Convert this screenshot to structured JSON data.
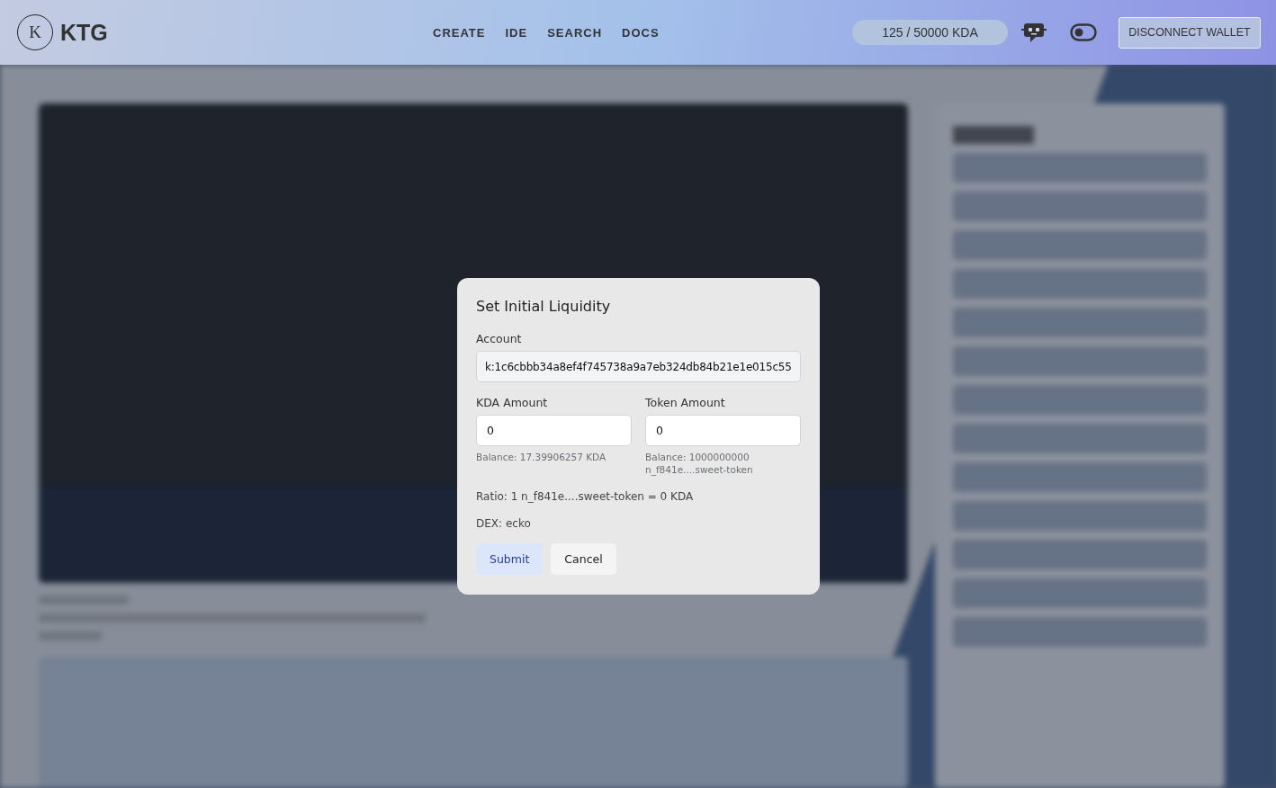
{
  "header": {
    "logo_letter": "K",
    "brand": "KTG",
    "nav": [
      {
        "label": "CREATE"
      },
      {
        "label": "IDE"
      },
      {
        "label": "SEARCH"
      },
      {
        "label": "DOCS"
      }
    ],
    "balance": "125 / 50000 KDA",
    "theme_toggle": {
      "on": false
    },
    "wallet_button": "DISCONNECT WALLET"
  },
  "dialog": {
    "title": "Set Initial Liquidity",
    "account": {
      "label": "Account",
      "value": "k:1c6cbbb34a8ef4f745738a9a7eb324db84b21e1e015c55"
    },
    "amounts": [
      {
        "label": "KDA Amount",
        "value": "0",
        "hint": [
          "Balance: 17.39906257 KDA"
        ]
      },
      {
        "label": "Token Amount",
        "value": "0",
        "hint": [
          "Balance: 1000000000",
          "n_f841e....sweet-token"
        ]
      }
    ],
    "ratio": "Ratio: 1 n_f841e....sweet-token = 0 KDA",
    "dex": "DEX: ecko",
    "buttons": [
      {
        "label": "Submit",
        "kind": "primary"
      },
      {
        "label": "Cancel",
        "kind": "secondary"
      }
    ]
  }
}
